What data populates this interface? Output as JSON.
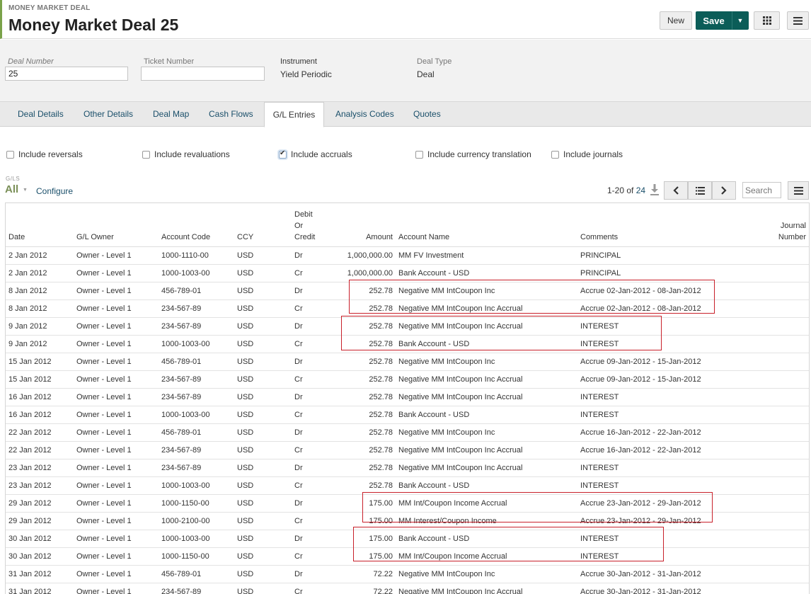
{
  "header": {
    "kicker": "MONEY MARKET DEAL",
    "title": "Money Market Deal 25",
    "new_label": "New",
    "save_label": "Save"
  },
  "deal": {
    "deal_number_label": "Deal Number",
    "deal_number_value": "25",
    "ticket_number_label": "Ticket Number",
    "ticket_number_value": "",
    "instrument_label": "Instrument",
    "instrument_value": "Yield Periodic",
    "deal_type_label": "Deal Type",
    "deal_type_value": "Deal"
  },
  "tabs": [
    {
      "label": "Deal Details"
    },
    {
      "label": "Other Details"
    },
    {
      "label": "Deal Map"
    },
    {
      "label": "Cash Flows"
    },
    {
      "label": "G/L Entries",
      "active": true
    },
    {
      "label": "Analysis Codes"
    },
    {
      "label": "Quotes"
    }
  ],
  "filters": [
    {
      "label": "Include reversals",
      "checked": false
    },
    {
      "label": "Include revaluations",
      "checked": false
    },
    {
      "label": "Include accruals",
      "checked": true
    },
    {
      "label": "Include currency translation",
      "checked": false
    },
    {
      "label": "Include journals",
      "checked": false
    }
  ],
  "gls": {
    "label": "G/LS",
    "selected": "All",
    "configure": "Configure"
  },
  "pager": {
    "range": "1-20 of",
    "total": "24",
    "search_placeholder": "Search"
  },
  "table": {
    "headers": {
      "date": "Date",
      "owner": "G/L Owner",
      "account_code": "Account Code",
      "ccy": "CCY",
      "dc_1": "Debit",
      "dc_2": "Or",
      "dc_3": "Credit",
      "amount": "Amount",
      "account_name": "Account Name",
      "comments": "Comments",
      "journal_1": "Journal",
      "journal_2": "Number"
    },
    "rows": [
      {
        "date": "2 Jan 2012",
        "owner": "Owner - Level 1",
        "code": "1000-1110-00",
        "ccy": "USD",
        "dc": "Dr",
        "amount": "1,000,000.00",
        "name": "MM FV Investment",
        "comments": "PRINCIPAL",
        "journal": ""
      },
      {
        "date": "2 Jan 2012",
        "owner": "Owner - Level 1",
        "code": "1000-1003-00",
        "ccy": "USD",
        "dc": "Cr",
        "amount": "1,000,000.00",
        "name": "Bank Account - USD",
        "comments": "PRINCIPAL",
        "journal": ""
      },
      {
        "date": "8 Jan 2012",
        "owner": "Owner - Level 1",
        "code": "456-789-01",
        "ccy": "USD",
        "dc": "Dr",
        "amount": "252.78",
        "name": "Negative MM IntCoupon Inc",
        "comments": "Accrue 02-Jan-2012 - 08-Jan-2012",
        "journal": ""
      },
      {
        "date": "8 Jan 2012",
        "owner": "Owner - Level 1",
        "code": "234-567-89",
        "ccy": "USD",
        "dc": "Cr",
        "amount": "252.78",
        "name": "Negative MM IntCoupon Inc Accrual",
        "comments": "Accrue 02-Jan-2012 - 08-Jan-2012",
        "journal": ""
      },
      {
        "date": "9 Jan 2012",
        "owner": "Owner - Level 1",
        "code": "234-567-89",
        "ccy": "USD",
        "dc": "Dr",
        "amount": "252.78",
        "name": "Negative MM IntCoupon Inc Accrual",
        "comments": "INTEREST",
        "journal": ""
      },
      {
        "date": "9 Jan 2012",
        "owner": "Owner - Level 1",
        "code": "1000-1003-00",
        "ccy": "USD",
        "dc": "Cr",
        "amount": "252.78",
        "name": "Bank Account - USD",
        "comments": "INTEREST",
        "journal": ""
      },
      {
        "date": "15 Jan 2012",
        "owner": "Owner - Level 1",
        "code": "456-789-01",
        "ccy": "USD",
        "dc": "Dr",
        "amount": "252.78",
        "name": "Negative MM IntCoupon Inc",
        "comments": "Accrue 09-Jan-2012 - 15-Jan-2012",
        "journal": ""
      },
      {
        "date": "15 Jan 2012",
        "owner": "Owner - Level 1",
        "code": "234-567-89",
        "ccy": "USD",
        "dc": "Cr",
        "amount": "252.78",
        "name": "Negative MM IntCoupon Inc Accrual",
        "comments": "Accrue 09-Jan-2012 - 15-Jan-2012",
        "journal": ""
      },
      {
        "date": "16 Jan 2012",
        "owner": "Owner - Level 1",
        "code": "234-567-89",
        "ccy": "USD",
        "dc": "Dr",
        "amount": "252.78",
        "name": "Negative MM IntCoupon Inc Accrual",
        "comments": "INTEREST",
        "journal": ""
      },
      {
        "date": "16 Jan 2012",
        "owner": "Owner - Level 1",
        "code": "1000-1003-00",
        "ccy": "USD",
        "dc": "Cr",
        "amount": "252.78",
        "name": "Bank Account - USD",
        "comments": "INTEREST",
        "journal": ""
      },
      {
        "date": "22 Jan 2012",
        "owner": "Owner - Level 1",
        "code": "456-789-01",
        "ccy": "USD",
        "dc": "Dr",
        "amount": "252.78",
        "name": "Negative MM IntCoupon Inc",
        "comments": "Accrue 16-Jan-2012 - 22-Jan-2012",
        "journal": ""
      },
      {
        "date": "22 Jan 2012",
        "owner": "Owner - Level 1",
        "code": "234-567-89",
        "ccy": "USD",
        "dc": "Cr",
        "amount": "252.78",
        "name": "Negative MM IntCoupon Inc Accrual",
        "comments": "Accrue 16-Jan-2012 - 22-Jan-2012",
        "journal": ""
      },
      {
        "date": "23 Jan 2012",
        "owner": "Owner - Level 1",
        "code": "234-567-89",
        "ccy": "USD",
        "dc": "Dr",
        "amount": "252.78",
        "name": "Negative MM IntCoupon Inc Accrual",
        "comments": "INTEREST",
        "journal": ""
      },
      {
        "date": "23 Jan 2012",
        "owner": "Owner - Level 1",
        "code": "1000-1003-00",
        "ccy": "USD",
        "dc": "Cr",
        "amount": "252.78",
        "name": "Bank Account - USD",
        "comments": "INTEREST",
        "journal": ""
      },
      {
        "date": "29 Jan 2012",
        "owner": "Owner - Level 1",
        "code": "1000-1150-00",
        "ccy": "USD",
        "dc": "Dr",
        "amount": "175.00",
        "name": "MM Int/Coupon Income Accrual",
        "comments": "Accrue 23-Jan-2012 - 29-Jan-2012",
        "journal": ""
      },
      {
        "date": "29 Jan 2012",
        "owner": "Owner - Level 1",
        "code": "1000-2100-00",
        "ccy": "USD",
        "dc": "Cr",
        "amount": "175.00",
        "name": "MM Interest/Coupon Income",
        "comments": "Accrue 23-Jan-2012 - 29-Jan-2012",
        "journal": ""
      },
      {
        "date": "30 Jan 2012",
        "owner": "Owner - Level 1",
        "code": "1000-1003-00",
        "ccy": "USD",
        "dc": "Dr",
        "amount": "175.00",
        "name": "Bank Account - USD",
        "comments": "INTEREST",
        "journal": ""
      },
      {
        "date": "30 Jan 2012",
        "owner": "Owner - Level 1",
        "code": "1000-1150-00",
        "ccy": "USD",
        "dc": "Cr",
        "amount": "175.00",
        "name": "MM Int/Coupon Income Accrual",
        "comments": "INTEREST",
        "journal": ""
      },
      {
        "date": "31 Jan 2012",
        "owner": "Owner - Level 1",
        "code": "456-789-01",
        "ccy": "USD",
        "dc": "Dr",
        "amount": "72.22",
        "name": "Negative MM IntCoupon Inc",
        "comments": "Accrue 30-Jan-2012 - 31-Jan-2012",
        "journal": ""
      },
      {
        "date": "31 Jan 2012",
        "owner": "Owner - Level 1",
        "code": "234-567-89",
        "ccy": "USD",
        "dc": "Cr",
        "amount": "72.22",
        "name": "Negative MM IntCoupon Inc Accrual",
        "comments": "Accrue 30-Jan-2012 - 31-Jan-2012",
        "journal": ""
      }
    ]
  },
  "colors": {
    "accent_green": "#7aa24a",
    "save_button": "#0b5d58",
    "link": "#1a4f6a",
    "highlight_box": "#c8202a"
  },
  "icons": {
    "save_caret": "caret-down-icon",
    "grid": "grid-icon",
    "menu": "hamburger-menu-icon",
    "download": "download-icon",
    "prev": "chevron-left-icon",
    "list": "list-icon",
    "next": "chevron-right-icon"
  }
}
